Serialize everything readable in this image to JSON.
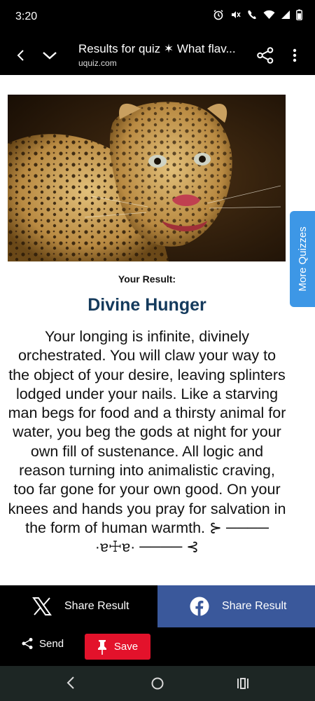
{
  "status_bar": {
    "time": "3:20",
    "icons": [
      "alarm-icon",
      "mute-icon",
      "call-icon",
      "wifi-icon",
      "signal-icon",
      "battery-icon"
    ]
  },
  "app_bar": {
    "title": "Results for quiz ✶ What flav...",
    "domain": "uquiz.com",
    "icons": [
      "back-arrow-icon",
      "chevron-down-icon",
      "share-icon",
      "more-vert-icon"
    ]
  },
  "result": {
    "label": "Your Result:",
    "title": "Divine Hunger",
    "description": "Your longing is infinite, divinely orchestrated. You will claw your way to the object of your desire, leaving splinters lodged under your nails. Like a starving man begs for food and a thirsty animal for water, you beg the gods at night for your own fill of sustenance. All logic and reason turning into animalistic craving, too far gone for your own good. On your knees and hands you pray for salvation in the form of human warmth. ⊱ ──── ·ɐ☩ɐ· ──── ⊰",
    "image": "leopard-photo"
  },
  "side_tab": {
    "label": "More Quizzes"
  },
  "share": {
    "x_label": "Share Result",
    "facebook_label": "Share Result"
  },
  "actions": {
    "send_label": "Send",
    "save_label": "Save"
  },
  "colors": {
    "title_color": "#143a5c",
    "side_tab": "#3d97e6",
    "facebook": "#3a589b",
    "save": "#e3122b",
    "nav_bar": "#1d2624"
  }
}
